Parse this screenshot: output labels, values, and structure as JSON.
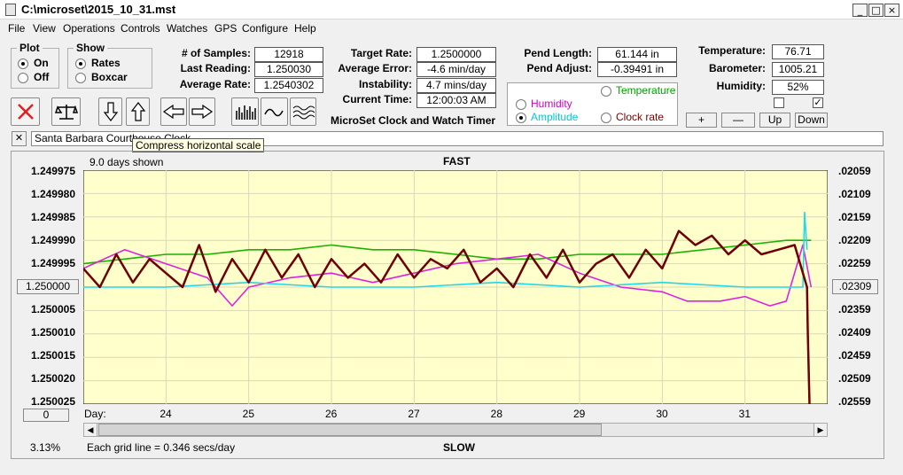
{
  "window": {
    "title": "C:\\microset\\2015_10_31.mst",
    "minimize": "_",
    "maximize": "□",
    "close": "×"
  },
  "menu": [
    "File",
    "View",
    "Operations",
    "Controls",
    "Watches",
    "GPS",
    "Configure",
    "Help"
  ],
  "plot_group": {
    "title": "Plot",
    "options": [
      "On",
      "Off"
    ],
    "selected": "On"
  },
  "show_group": {
    "title": "Show",
    "options": [
      "Rates",
      "Boxcar"
    ],
    "selected": "Rates"
  },
  "stats": {
    "samples_label": "# of Samples:",
    "samples": "12918",
    "last_reading_label": "Last Reading:",
    "last_reading": "1.250030",
    "average_rate_label": "Average Rate:",
    "average_rate": "1.2540302",
    "target_rate_label": "Target Rate:",
    "target_rate": "1.2500000",
    "average_error_label": "Average Error:",
    "average_error": "-4.6 min/day",
    "instability_label": "Instability:",
    "instability": "4.7 mins/day",
    "current_time_label": "Current Time:",
    "current_time": "12:00:03 AM",
    "pend_length_label": "Pend Length:",
    "pend_length": "61.144 in",
    "pend_adjust_label": "Pend Adjust:",
    "pend_adjust": "-0.39491 in",
    "temperature_label": "Temperature:",
    "temperature": "76.71",
    "barometer_label": "Barometer:",
    "barometer": "1005.21",
    "humidity_label": "Humidity:",
    "humidity": "52%"
  },
  "app_caption": "MicroSet Clock and Watch Timer",
  "sensor_options": [
    {
      "label": "Temperature",
      "color": "#00a000",
      "selected": false
    },
    {
      "label": "Humidity",
      "color": "#cc00cc",
      "selected": false
    },
    {
      "label": "Amplitude",
      "color": "#00c8d8",
      "selected": true
    },
    {
      "label": "Clock rate",
      "color": "#7a0000",
      "selected": false
    }
  ],
  "adjust_buttons": [
    "+",
    "—",
    "Up",
    "Down"
  ],
  "checkboxes": [
    {
      "checked": false
    },
    {
      "checked": true
    }
  ],
  "watch_name": "Santa Barbara Courthouse Clock",
  "clear_button": "✕",
  "tooltip": "Compress horizontal scale",
  "toolbar_icons": [
    "close-x-icon",
    "balance-icon",
    "arrow-down-icon",
    "arrow-up-icon",
    "arrow-left-icon",
    "arrow-right-icon",
    "bars-icon",
    "wave-icon",
    "multi-wave-icon"
  ],
  "chart": {
    "days_shown": "9.0 days shown",
    "top_label": "FAST",
    "bottom_label": "SLOW",
    "left_button": "1.250000",
    "right_button": ".02309",
    "bottom_left_button": "0",
    "percent": "3.13%",
    "grid_note": "Each grid line = 0.346 secs/day",
    "day_label": "Day:"
  },
  "chart_data": {
    "type": "line",
    "x_unit": "day",
    "x_ticks": [
      "24",
      "25",
      "26",
      "27",
      "28",
      "29",
      "30",
      "31"
    ],
    "xlim": [
      23.0,
      32.0
    ],
    "y_left_ticks": [
      "1.249975",
      "1.249980",
      "1.249985",
      "1.249990",
      "1.249995",
      "1.250000",
      "1.250005",
      "1.250010",
      "1.250015",
      "1.250020",
      "1.250025"
    ],
    "ylim_left": [
      1.249975,
      1.250025
    ],
    "y_right_ticks": [
      ".02059",
      ".02109",
      ".02159",
      ".02209",
      ".02259",
      ".02309",
      ".02359",
      ".02409",
      ".02459",
      ".02509",
      ".02559"
    ],
    "series": [
      {
        "color": "#1ab200",
        "x": [
          23.0,
          23.5,
          24.0,
          24.5,
          25.0,
          25.5,
          26.0,
          26.5,
          27.0,
          27.5,
          28.0,
          28.5,
          29.0,
          29.5,
          30.0,
          30.5,
          31.0,
          31.5,
          31.8
        ],
        "y": [
          1.249995,
          1.249994,
          1.249993,
          1.249993,
          1.249992,
          1.249992,
          1.249991,
          1.249992,
          1.249992,
          1.249993,
          1.249994,
          1.249994,
          1.249993,
          1.249993,
          1.249993,
          1.249992,
          1.249991,
          1.24999,
          1.24999
        ]
      },
      {
        "color": "#dd22dd",
        "x": [
          23.0,
          23.5,
          24.0,
          24.5,
          24.8,
          25.0,
          25.5,
          26.0,
          26.5,
          27.0,
          27.5,
          28.0,
          28.5,
          29.0,
          29.5,
          30.0,
          30.3,
          30.7,
          31.0,
          31.3,
          31.5,
          31.7,
          31.8
        ],
        "y": [
          1.249996,
          1.249992,
          1.249995,
          1.249998,
          1.250004,
          1.25,
          1.249998,
          1.249997,
          1.249999,
          1.249997,
          1.249995,
          1.249994,
          1.249993,
          1.249997,
          1.25,
          1.250001,
          1.250003,
          1.250003,
          1.250002,
          1.250004,
          1.250003,
          1.249991,
          1.25
        ]
      },
      {
        "color": "#22d8e8",
        "x": [
          23.0,
          24.0,
          25.0,
          26.0,
          27.0,
          28.0,
          29.0,
          30.0,
          31.0,
          31.7,
          31.72,
          31.75
        ],
        "y": [
          1.25,
          1.25,
          1.249999,
          1.25,
          1.25,
          1.249999,
          1.25,
          1.249999,
          1.25,
          1.25,
          1.249984,
          1.249992
        ]
      },
      {
        "color": "#6e0000",
        "x": [
          23.0,
          23.2,
          23.4,
          23.6,
          23.8,
          24.0,
          24.2,
          24.4,
          24.6,
          24.8,
          25.0,
          25.2,
          25.4,
          25.6,
          25.8,
          26.0,
          26.2,
          26.4,
          26.6,
          26.8,
          27.0,
          27.2,
          27.4,
          27.6,
          27.8,
          28.0,
          28.2,
          28.4,
          28.6,
          28.8,
          29.0,
          29.2,
          29.4,
          29.6,
          29.8,
          30.0,
          30.2,
          30.4,
          30.6,
          30.8,
          31.0,
          31.2,
          31.4,
          31.6,
          31.75,
          31.76,
          31.78
        ],
        "y": [
          1.249996,
          1.25,
          1.249993,
          1.249999,
          1.249994,
          1.249997,
          1.25,
          1.249991,
          1.250001,
          1.249994,
          1.249999,
          1.249992,
          1.249998,
          1.249993,
          1.25,
          1.249994,
          1.249998,
          1.249995,
          1.249999,
          1.249993,
          1.249998,
          1.249994,
          1.249996,
          1.249992,
          1.249999,
          1.249996,
          1.25,
          1.249993,
          1.249998,
          1.249992,
          1.249999,
          1.249995,
          1.249993,
          1.249998,
          1.249992,
          1.249996,
          1.249988,
          1.249991,
          1.249989,
          1.249993,
          1.24999,
          1.249993,
          1.249992,
          1.249991,
          1.25,
          1.25001,
          1.250025
        ]
      }
    ]
  }
}
